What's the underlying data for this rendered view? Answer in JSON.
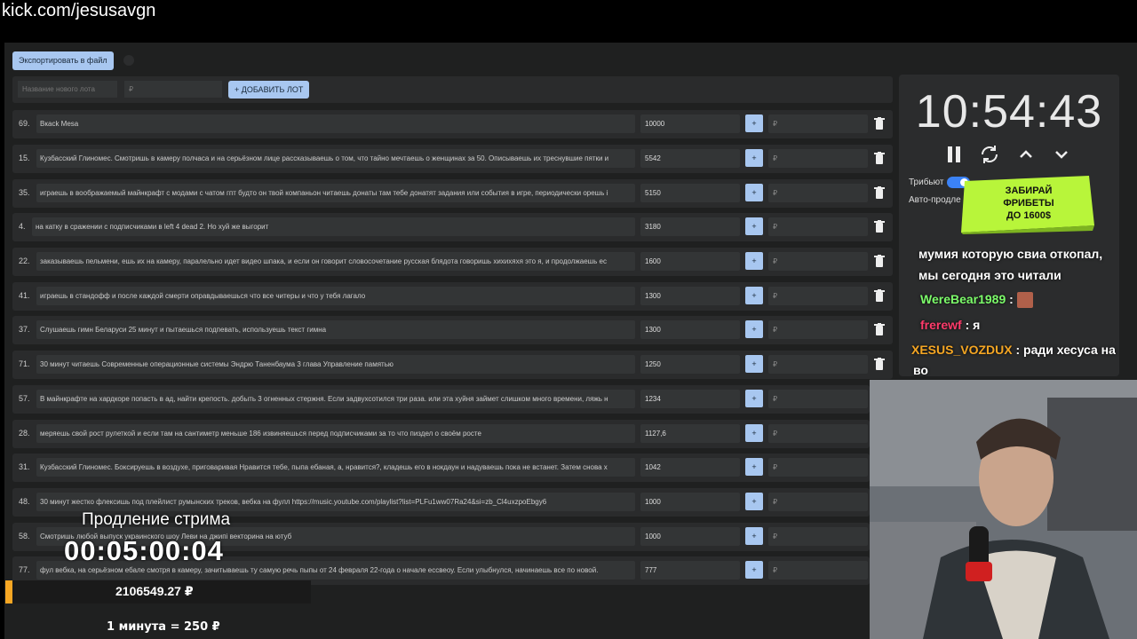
{
  "url": "kick.com/jesusavgn",
  "toolbar": {
    "export_label": "Экспортировать в файл"
  },
  "add_lot": {
    "name_placeholder": "Название нового лота",
    "price_placeholder": "₽",
    "button_label": "+ ДОБАВИТЬ ЛОТ"
  },
  "lots": [
    {
      "num": "69.",
      "name": "Bкаck Mesa",
      "amount": "10000",
      "price_placeholder": "₽"
    },
    {
      "num": "15.",
      "name": "Кузбасский Глиномес. Смотришь в камеру полчаса и на серьёзном лице рассказываешь о том, что тайно мечтаешь о женщинах за 50. Описываешь их треснувшие пятки и",
      "amount": "5542",
      "price_placeholder": "₽"
    },
    {
      "num": "35.",
      "name": "играешь в воображаемый майнкрафт с модами с чатом гпт будто он твой компаньон читаешь донаты там тебе донатят задания или события в игре, периодически орешь i",
      "amount": "5150",
      "price_placeholder": "₽"
    },
    {
      "num": "4.",
      "name": "на катку в сражении с подписчиками в left 4 dead 2. Но хуй же выгорит",
      "amount": "3180",
      "price_placeholder": "₽"
    },
    {
      "num": "22.",
      "name": "заказываешь пельмени, ешь их на камеру, паралельно идет видео шпака, и если он говорит словосочетание русская блядота говоришь хихихяхя это я, и продолжаешь ес",
      "amount": "1600",
      "price_placeholder": "₽"
    },
    {
      "num": "41.",
      "name": "играешь в стандофф и после каждой смерти оправдываешься что все читеры и что у тебя лагало",
      "amount": "1300",
      "price_placeholder": "₽"
    },
    {
      "num": "37.",
      "name": "Слушаешь гимн Беларуси 25 минут и пытаешься подпевать, используешь текст гимна",
      "amount": "1300",
      "price_placeholder": "₽"
    },
    {
      "num": "71.",
      "name": "30 минут читаешь Современные операционные системы Эндрю Таненбаума 3 глава Управление памятью",
      "amount": "1250",
      "price_placeholder": "₽"
    },
    {
      "num": "57.",
      "name": "В майнкрафте на хардкоре попасть в ад, найти крепость. добыть 3 огненных стержня. Если задвухсотился три раза. или эта хуйня займет слишком много времени, ляжь н",
      "amount": "1234",
      "price_placeholder": "₽"
    },
    {
      "num": "28.",
      "name": "меряешь свой рост рулеткой и если там на сантиметр меньше 186 извиняешься перед подписчиками за то что пиздел о своём росте",
      "amount": "1127,6",
      "price_placeholder": "₽"
    },
    {
      "num": "31.",
      "name": "Кузбасский Глиномес. Боксируешь в воздухе, приговаривая Нравится тебе, пыпа ебаная, а, нравится?, кладешь его в нокдаун и надуваешь пока не встанет. Затем снова х",
      "amount": "1042",
      "price_placeholder": "₽"
    },
    {
      "num": "48.",
      "name": "30 минут жестко флексишь под плейлист румынских треков, вебка на фулл https://music.youtube.com/playlist?list=PLFu1ww07Ra24&si=zb_Cl4uxzpoEbgy6",
      "amount": "1000",
      "price_placeholder": "₽"
    },
    {
      "num": "58.",
      "name": "Смотришь любой выпуск украинского шоу Леви на джипі векторина на ютуб",
      "amount": "1000",
      "price_placeholder": "₽"
    },
    {
      "num": "77.",
      "name": "фул вебка, на серьёзном ебале смотря в камеру, зачитываешь ту самую речь пыпы от 24 февраля 22-года о начале есcвеоу. Если улыбнулся, начинаешь все по новой.",
      "amount": "777",
      "price_placeholder": "₽"
    }
  ],
  "timer": {
    "time": "10:54:43",
    "tribute_label": "Трибьют",
    "auto_label": "Авто-продле"
  },
  "promo": {
    "line1": "ЗАБИРАЙ",
    "line2": "ФРИБЕТЫ",
    "line3": "ДО 1600$"
  },
  "chat": {
    "messages": [
      {
        "user": "",
        "text": "мумия которую свиа откопал,",
        "color": "#ffffff"
      },
      {
        "user": "",
        "text": "мы сегодня это читали",
        "color": "#ffffff"
      },
      {
        "user": "WereBear1989",
        "text": ":",
        "color": "#7cfc6a"
      },
      {
        "user": "frerewf",
        "text": ": я",
        "color": "#ff3b6b"
      },
      {
        "user": "XESUS_VOZDUX",
        "text": ": ради хесуса на",
        "color": "#f5a623"
      },
      {
        "user": "",
        "text": "во",
        "color": "#ffffff"
      }
    ]
  },
  "extension": {
    "title": "Продление стрима",
    "time": "00:05:00:04",
    "total": "2106549.27 ₽",
    "rate": "1 минута = 250 ₽"
  },
  "colors": {
    "accent": "#a8c7f0",
    "background": "#1f2020",
    "row": "#2a2b2c",
    "field": "#333536",
    "toggle": "#3b82f6",
    "total_accent": "#f5a623",
    "promo": "#b8f53a"
  }
}
